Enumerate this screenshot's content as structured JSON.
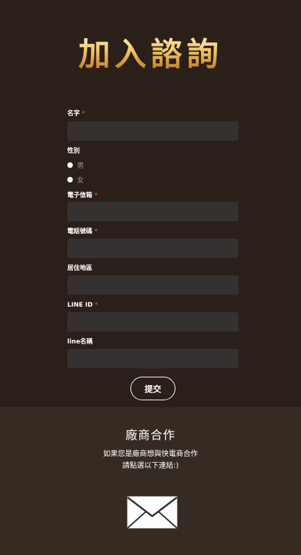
{
  "header": {
    "title": "加入諮詢"
  },
  "form": {
    "name": {
      "label": "名字",
      "required": "*",
      "value": ""
    },
    "gender": {
      "label": "性別",
      "options": [
        "男",
        "女"
      ]
    },
    "email": {
      "label": "電子信箱",
      "required": "*",
      "value": ""
    },
    "phone": {
      "label": "電話號碼",
      "required": "*",
      "value": ""
    },
    "area": {
      "label": "居住地區",
      "value": ""
    },
    "line_id": {
      "label": "LINE ID",
      "required": "*",
      "value": ""
    },
    "line_name": {
      "label": "line名稱",
      "value": ""
    },
    "submit_label": "提交"
  },
  "partner": {
    "title": "廠商合作",
    "line1": "如果您是廠商想與快電商合作",
    "line2": "請點選以下連結:)",
    "icon": "mail-envelope-icon"
  },
  "colors": {
    "background": "#2a2019",
    "footer_background": "#352b23",
    "input_background": "#353130",
    "required": "#e0432f",
    "title_gold": "#f3c86a"
  }
}
